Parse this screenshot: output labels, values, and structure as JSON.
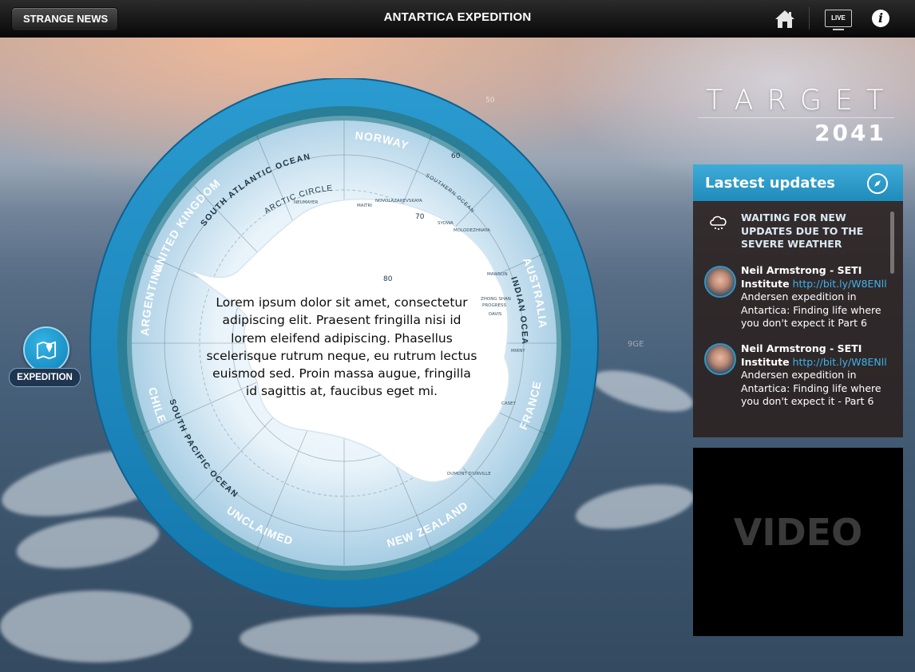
{
  "topbar": {
    "back_label": "STRANGE NEWS",
    "title": "ANTARTICA EXPEDITION",
    "live_label": "LIVE",
    "info_label": "i"
  },
  "dial": {
    "countries": [
      "UNITED KINGDOM",
      "NORWAY",
      "AUSTRALIA",
      "FRANCE",
      "NEW ZEALAND",
      "UNCLAIMED",
      "CHILE",
      "ARGENTINA"
    ],
    "oceans": [
      "SOUTH ATLANTIC OCEAN",
      "INDIAN OCEAN",
      "SOUTH PACIFIC OCEAN",
      "SOUTHERN OCEAN"
    ],
    "arctic_circle": "ARCTIC CIRCLE",
    "degrees": [
      "0",
      "50",
      "60",
      "70",
      "80"
    ],
    "side_marker": "9GE",
    "stations": [
      "NEUMAYER",
      "MAITRI",
      "NOVOLAZAREVSKAYA",
      "SYOWA",
      "MOLODEZHNAYA",
      "MAWSON",
      "ZHONG SHAN",
      "PROGRESS",
      "DAVIS",
      "MIRNY",
      "CASEY",
      "DUMONT D'URVILLE"
    ],
    "center_text": "Lorem ipsum dolor sit amet, consectetur adipiscing elit. Praesent fringilla nisi id lorem eleifend adipiscing. Phasellus scelerisque rutrum neque, eu rutrum lectus euismod sed. Proin massa augue, fringilla id sagittis at, faucibus eget mi."
  },
  "expedition": {
    "label": "EXPEDITION",
    "icon": "map-pin-icon"
  },
  "target": {
    "word": "TARGET",
    "year": "2041"
  },
  "updates": {
    "title": "Lastest updates",
    "weather_notice": "WAITING FOR NEW UPDATES DUE TO THE SEVERE WEATHER",
    "tweets": [
      {
        "name": "Neil Armstrong - SETI Institute",
        "link": "http://bit.ly/W8ENll",
        "text": "Andersen expedition in Antartica: Finding life where you don't expect it  Part 6"
      },
      {
        "name": "Neil Armstrong - SETI Institute",
        "link": "http://bit.ly/W8ENll",
        "text": "Andersen expedition in Antartica: Finding life where you don't expect it - Part 6"
      }
    ]
  },
  "video": {
    "label": "VIDEO"
  },
  "colors": {
    "accent": "#1f8bbb",
    "ring": "#2a8fc4",
    "link": "#3db4ea"
  }
}
